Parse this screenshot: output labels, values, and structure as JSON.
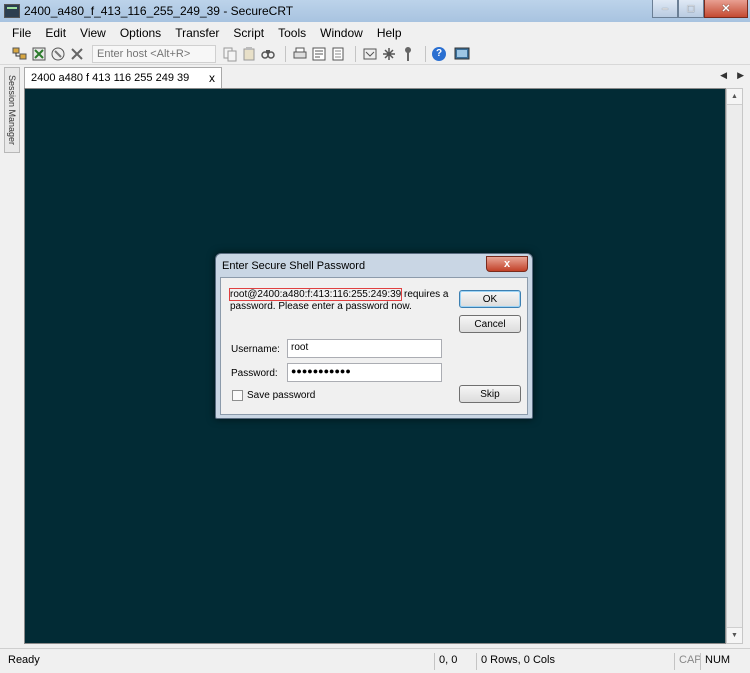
{
  "window": {
    "title": "2400_a480_f_413_116_255_249_39 - SecureCRT",
    "controls": {
      "minimize": "–",
      "maximize": "□",
      "close": "✕"
    }
  },
  "menu": [
    "File",
    "Edit",
    "View",
    "Options",
    "Transfer",
    "Script",
    "Tools",
    "Window",
    "Help"
  ],
  "toolbar": {
    "quick_connect_placeholder": "Enter host <Alt+R>",
    "icons": [
      "connect-icon",
      "reconnect-icon",
      "disconnect-icon",
      "copy-icon",
      "paste-icon",
      "find-icon",
      "print-icon",
      "print-setup-icon",
      "session-options-icon",
      "sftp-icon",
      "keymap-icon",
      "help-icon",
      "screen-icon"
    ]
  },
  "session_manager": {
    "label": "Session Manager"
  },
  "tab": {
    "label": "2400 a480 f 413 116 255 249 39",
    "close": "x"
  },
  "tab_nav": {
    "prev": "◀",
    "next": "▶"
  },
  "terminal": {
    "background": "#022b35"
  },
  "status": {
    "ready": "Ready",
    "position": "0, 0",
    "size": "0 Rows, 0 Cols",
    "caps": "CAP",
    "num": "NUM"
  },
  "dialog": {
    "title": "Enter Secure Shell Password",
    "close": "x",
    "message_host": "root@2400:a480:f:413:116:255:249:39",
    "message_rest": " requires a password.  Please enter a password now.",
    "ok_label": "OK",
    "cancel_label": "Cancel",
    "skip_label": "Skip",
    "username_label": "Username:",
    "username_value": "root",
    "password_label": "Password:",
    "password_value": "●●●●●●●●●●●",
    "save_password_label": "Save password"
  }
}
